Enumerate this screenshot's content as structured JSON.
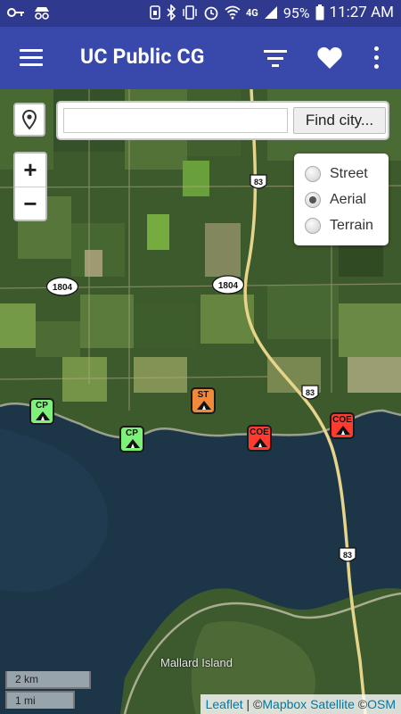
{
  "status_bar": {
    "battery": "95%",
    "time": "11:27 AM",
    "network": "4G"
  },
  "app_bar": {
    "title": "UC Public CG"
  },
  "search": {
    "value": "",
    "find_label": "Find city..."
  },
  "zoom": {
    "in_label": "+",
    "out_label": "−"
  },
  "layer_options": [
    {
      "label": "Street",
      "selected": false
    },
    {
      "label": "Aerial",
      "selected": true
    },
    {
      "label": "Terrain",
      "selected": false
    }
  ],
  "road_shields": {
    "us83": "83",
    "route1804": "1804"
  },
  "markers": [
    {
      "label": "CP",
      "type": "campground",
      "color": "#7ff07a"
    },
    {
      "label": "CP",
      "type": "campground",
      "color": "#7ff07a"
    },
    {
      "label": "ST",
      "type": "campground",
      "color": "#f08a3a"
    },
    {
      "label": "COE",
      "type": "campground",
      "color": "#ff3b30"
    },
    {
      "label": "COE",
      "type": "campground",
      "color": "#ff3b30"
    }
  ],
  "place_labels": {
    "island": "Mallard Island"
  },
  "scale": {
    "km": "2 km",
    "mi": "1 mi"
  },
  "attribution": {
    "leaflet": "Leaflet",
    "sep": " | ©",
    "mapbox": "Mapbox Satellite",
    "copy": " ©",
    "osm": "OSM"
  },
  "colors": {
    "status_bar": "#2f3a8f",
    "app_bar": "#3949ab",
    "water": "#1c3547",
    "land": "#3b5a2b"
  }
}
